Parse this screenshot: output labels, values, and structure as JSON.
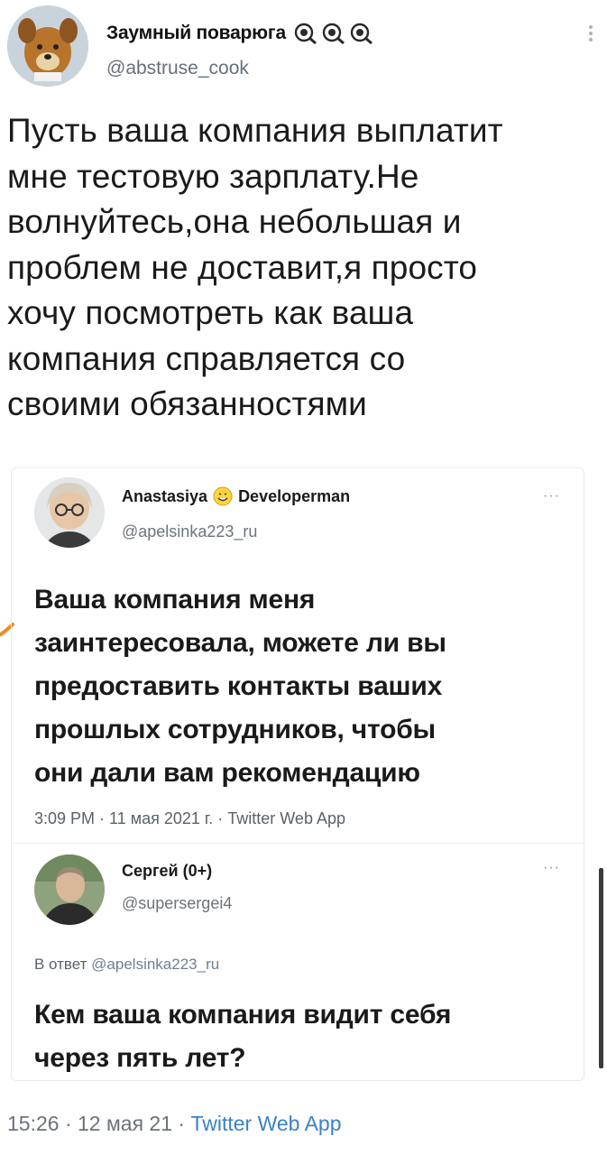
{
  "main_tweet": {
    "author_name": "Заумный поварюга",
    "author_handle": "@abstruse_cook",
    "badge_icons": [
      "magnifier-badge-icon",
      "magnifier-badge-icon",
      "magnifier-badge-icon"
    ],
    "text_lines": [
      "Пусть ваша компания выплатит",
      "мне тестовую зарплату.Не",
      "волнуйтесь,она небольшая и",
      "проблем не доставит,я просто",
      "хочу посмотреть как ваша",
      "компания справляется со",
      "своими обязанностями"
    ],
    "timestamp": "15:26 · 12 мая 21 · ",
    "source": "Twitter Web App"
  },
  "quoted_thread": {
    "quoted_tweet": {
      "author_name_part1": "Anastasiya",
      "author_name_part2": "Developerman",
      "author_handle": "@apelsinka223_ru",
      "more": "···",
      "text_lines": [
        "Ваша компания меня",
        "заинтересовала, можете ли вы",
        "предоставить контакты ваших",
        "прошлых сотрудников, чтобы",
        "они дали вам рекомендацию"
      ],
      "meta": "3:09 PM · 11 мая 2021 г. · Twitter Web App"
    },
    "reply": {
      "author_name": "Сергей (0+)",
      "author_handle": "@supersergei4",
      "more": "···",
      "replying_prefix": "В ответ ",
      "replying_to": "@apelsinka223_ru",
      "text_lines": [
        "Кем ваша компания видит себя",
        "через пять лет?"
      ]
    }
  },
  "colors": {
    "link": "#3b82c4",
    "muted": "#6b7279",
    "text": "#1a1a1a"
  }
}
